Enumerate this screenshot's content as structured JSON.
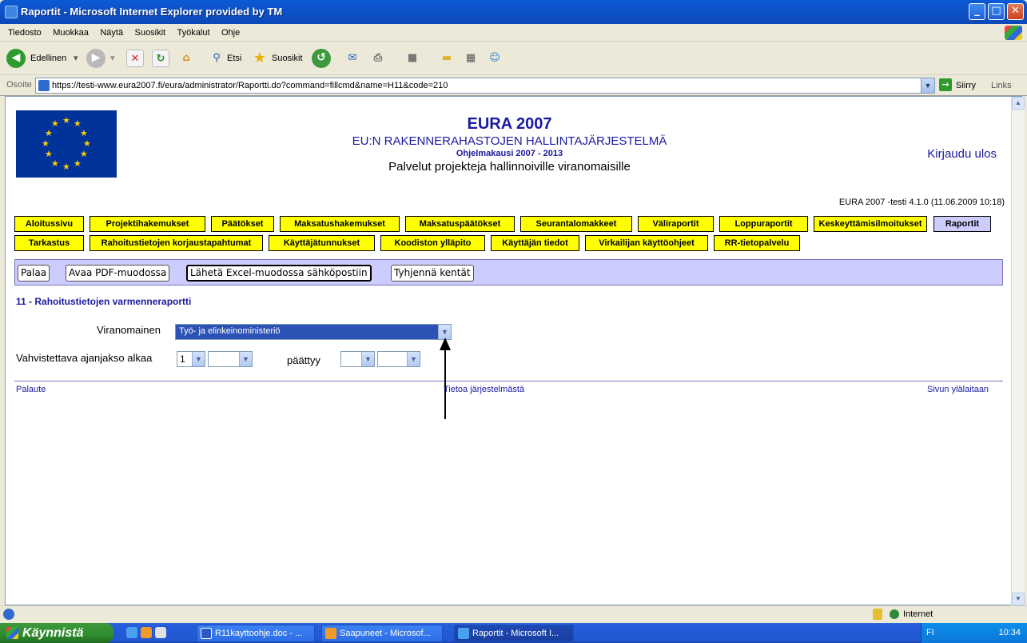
{
  "window": {
    "title": "Raportit - Microsoft Internet Explorer provided by TM",
    "controls": {
      "minimize": "_",
      "maximize": "□",
      "close": "✕"
    }
  },
  "menubar": [
    "Tiedosto",
    "Muokkaa",
    "Näytä",
    "Suosikit",
    "Työkalut",
    "Ohje"
  ],
  "toolbar": {
    "back_label": "Edellinen",
    "search_label": "Etsi",
    "favorites_label": "Suosikit"
  },
  "address": {
    "label": "Osoite",
    "url": "https://testi-www.eura2007.fi/eura/administrator/Raportti.do?command=fillcmd&name=H11&code=210",
    "go_label": "Siirry",
    "links_label": "Links"
  },
  "header": {
    "app_title": "EURA 2007",
    "subtitle": "EU:N RAKENNERAHASTOJEN HALLINTAJÄRJESTELMÄ",
    "period": "Ohjelmakausi 2007 - 2013",
    "service": "Palvelut projekteja hallinnoiville viranomaisille",
    "logout": "Kirjaudu ulos",
    "version": "EURA 2007 -testi 4.1.0 (11.06.2009 10:18)"
  },
  "nav": {
    "row1": [
      "Aloitussivu",
      "Projektihakemukset",
      "Päätökset",
      "Maksatushakemukset",
      "Maksatuspäätökset",
      "Seurantalomakkeet",
      "Väliraportit",
      "Loppuraportit",
      "Keskeyttämisilmoitukset",
      "Raportit"
    ],
    "row2": [
      "Tarkastus",
      "Rahoitustietojen korjaustapahtumat",
      "Käyttäjätunnukset",
      "Koodiston ylläpito",
      "Käyttäjän tiedot",
      "Virkailijan käyttöohjeet",
      "RR-tietopalvelu"
    ],
    "active": "Raportit"
  },
  "actions": {
    "back": "Palaa",
    "pdf": "Avaa PDF-muodossa",
    "excel": "Lähetä Excel-muodossa sähköpostiin",
    "clear": "Tyhjennä kentät"
  },
  "report": {
    "title": "11 - Rahoitustietojen varmenneraportti",
    "authority_label": "Viranomainen",
    "authority_value": "Työ- ja elinkeinoministeriö",
    "period_start_label": "Vahvistettava ajanjakso alkaa",
    "period_start_value": "1",
    "period_end_label": "päättyy"
  },
  "footer": {
    "feedback": "Palaute",
    "about": "Tietoa järjestelmästä",
    "top": "Sivun ylälaitaan"
  },
  "statusbar": {
    "zone": "Internet"
  },
  "taskbar": {
    "start": "Käynnistä",
    "tasks": [
      "R11kayttoohje.doc - ...",
      "Saapuneet - Microsof...",
      "Raportit - Microsoft I..."
    ],
    "lang": "FI",
    "clock": "10:34"
  }
}
